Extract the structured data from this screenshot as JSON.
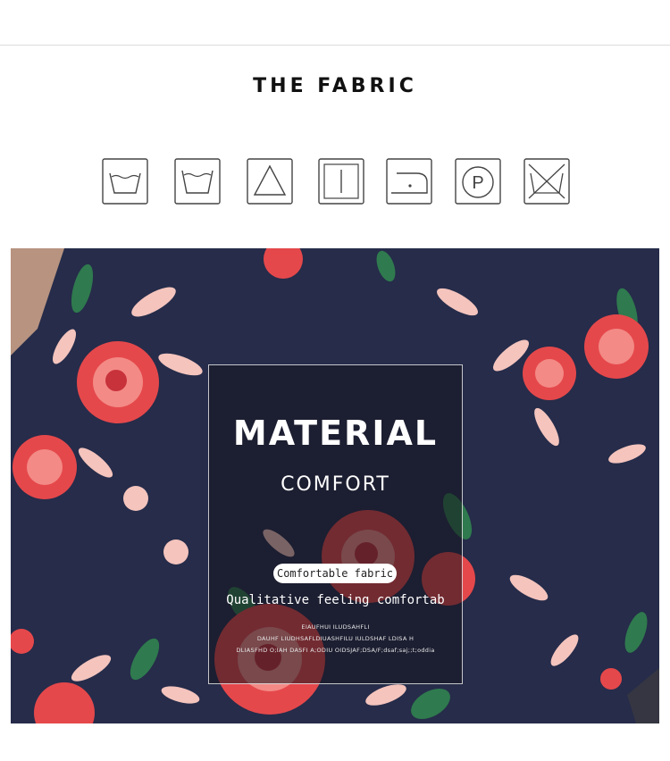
{
  "header": {
    "title": "THE FABRIC"
  },
  "care_icons": [
    {
      "name": "hand-wash-icon"
    },
    {
      "name": "machine-wash-icon"
    },
    {
      "name": "bleach-allowed-icon"
    },
    {
      "name": "line-dry-icon"
    },
    {
      "name": "iron-low-heat-icon"
    },
    {
      "name": "dry-clean-p-icon"
    },
    {
      "name": "do-not-tumble-dry-icon"
    }
  ],
  "care_symbols": {
    "dry_clean_letter": "P"
  },
  "feature": {
    "headline": "MATERIAL",
    "subhead": "COMFORT",
    "pill": "Comfortable fabric",
    "tagline": "Qualitative feeling comfortab",
    "fine_print": [
      "EIAUFHUI ILUDSAHFLI",
      "DAUHF LIUDHSAFLDIUASHFILU IULDSHAF LDISA H",
      "DLIASFHD O;IAH DASFI A;ODIU OIDSJAF;DSA/F;dsaf;saj;;t;oddia"
    ]
  },
  "colors": {
    "navy": "#262c4a",
    "rose": "#e5484b",
    "petal": "#f4c4bd",
    "leaf": "#2f7a4e"
  }
}
